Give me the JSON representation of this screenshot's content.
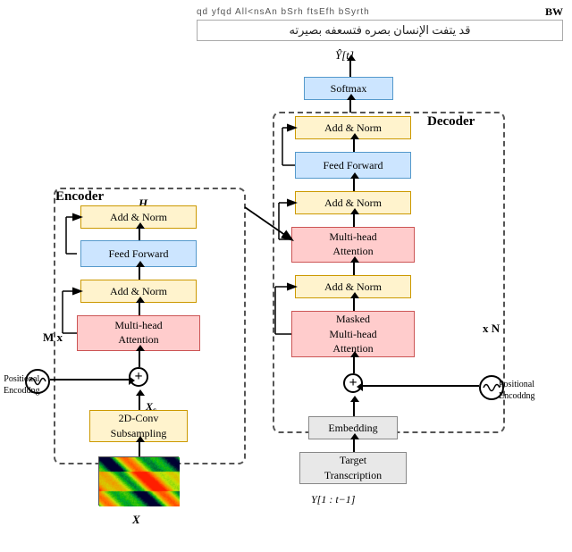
{
  "top": {
    "small_text": "qd  yfqd  All<nsAn  bSrh  ftsEfh  bSyrth",
    "bw_label": "BW",
    "arabic_text": "قد يتفت الإنسان بصره فتسعفه بصيرته"
  },
  "decoder": {
    "title": "Decoder",
    "softmax": "Softmax",
    "add_norm_top": "Add & Norm",
    "feed_forward": "Feed Forward",
    "add_norm_mid": "Add & Norm",
    "multihead_attention": "Multi-head\nAttention",
    "add_norm_bot": "Add & Norm",
    "masked_attention": "Masked\nMulti-head\nAttention",
    "positional_encoding": "Positional\nEncoddng",
    "embedding": "Embedding",
    "target_transcription": "Target\nTranscription",
    "y_input": "Y[1 : t−1]",
    "y_hat": "Ŷ[t]",
    "repeat": "x N"
  },
  "encoder": {
    "title": "Encoder",
    "he_label": "H_e",
    "add_norm_top": "Add & Norm",
    "feed_forward": "Feed Forward",
    "add_norm_bot": "Add & Norm",
    "multihead_attention": "Multi-head\nAttention",
    "positional_encoding": "Positional\nEncoddng",
    "conv2d": "2D-Conv\nSubsampling",
    "x_label": "X",
    "xs_label": "X_s",
    "repeat": "M x"
  }
}
